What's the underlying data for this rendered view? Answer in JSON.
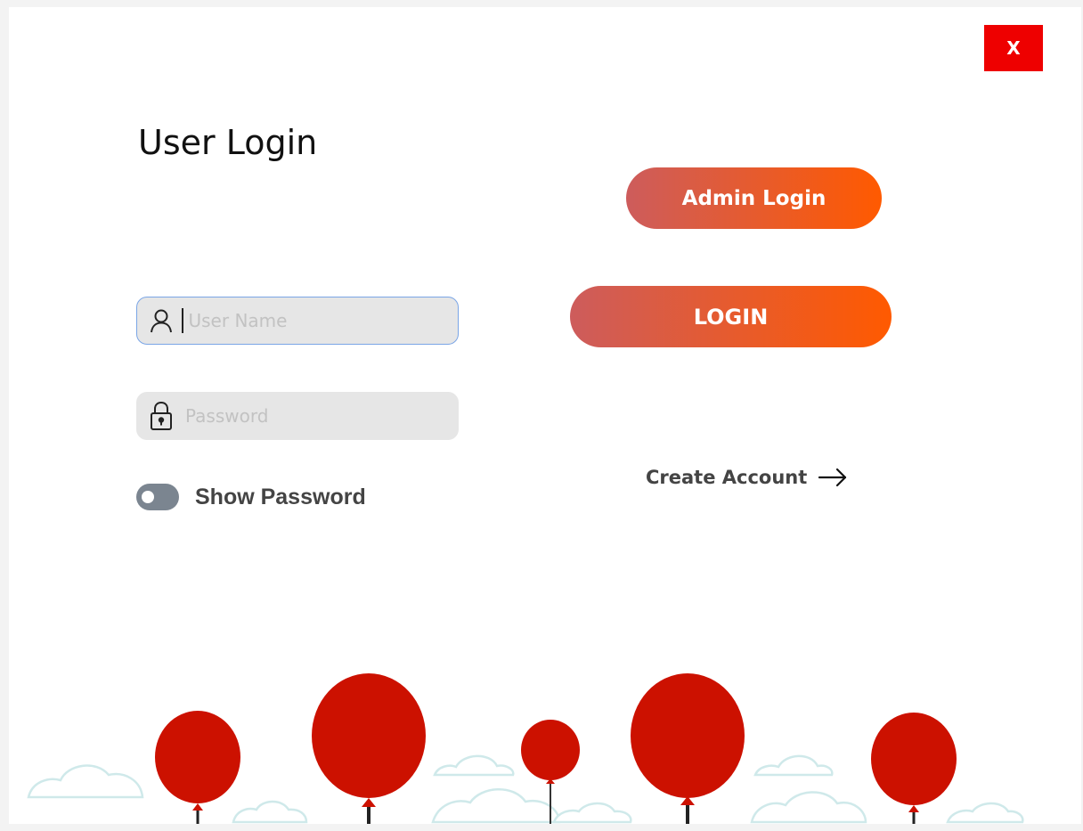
{
  "window": {
    "close_label": "X"
  },
  "header": {
    "title": "User Login"
  },
  "form": {
    "username_placeholder": "User Name",
    "username_value": "",
    "password_placeholder": "Password",
    "password_value": "",
    "show_password_label": "Show Password",
    "show_password_on": false
  },
  "actions": {
    "admin_login_label": "Admin Login",
    "login_label": "LOGIN",
    "create_account_label": "Create Account"
  },
  "icons": {
    "user": "user-icon",
    "lock": "lock-icon",
    "arrow": "arrow-right-icon",
    "close": "close-icon"
  },
  "colors": {
    "close_bg": "#ee0000",
    "button_gradient_start": "#cd5c5c",
    "button_gradient_end": "#ff5a00",
    "balloon": "#cc1100",
    "cloud_outline": "#cfe9ea",
    "focus_border": "#7aa5e6"
  }
}
